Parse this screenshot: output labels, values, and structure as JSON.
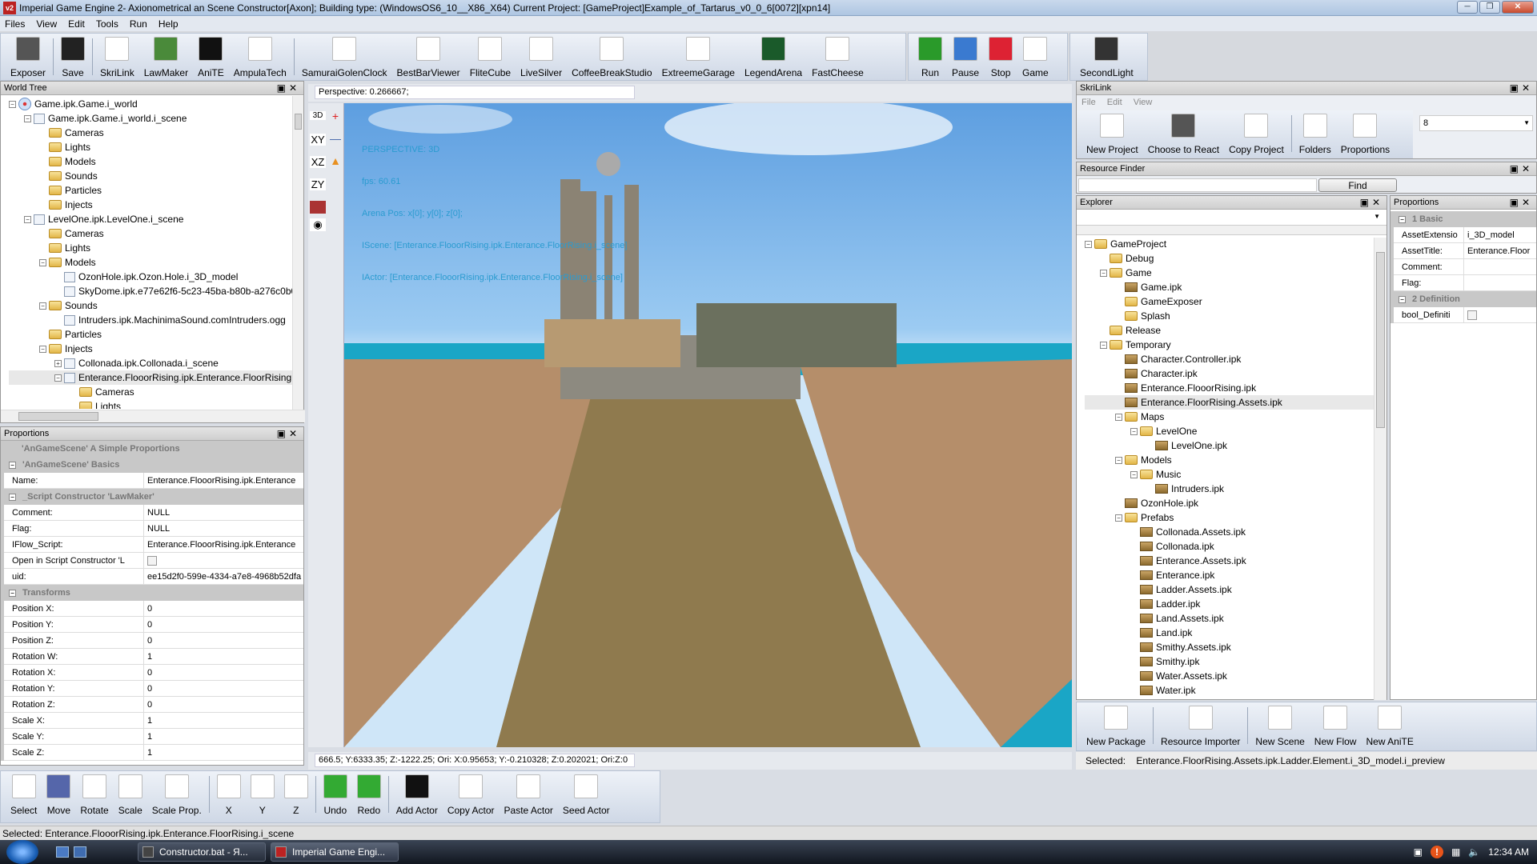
{
  "window": {
    "title": "Imperial Game Engine 2- Axionometrical an Scene Constructor[Axon]; Building type: (WindowsOS6_10__X86_X64) Current Project: [GameProject]Example_of_Tartarus_v0_0_6[0072][xpn14]",
    "app_icon": "v2"
  },
  "menu": [
    "Files",
    "View",
    "Edit",
    "Tools",
    "Run",
    "Help"
  ],
  "toolbar": {
    "group1": [
      {
        "label": "Exposer",
        "icon": "folder-download-icon"
      },
      {
        "label": "Save",
        "icon": "floppy-icon"
      },
      {
        "label": "SkriLink",
        "icon": "eagle-icon"
      },
      {
        "label": "LawMaker",
        "icon": "lawmaker-icon"
      },
      {
        "label": "AniTE",
        "icon": "clapperboard-icon"
      },
      {
        "label": "AmpulaTech",
        "icon": "document-arrow-icon"
      },
      {
        "label": "SamuraiGolenClock",
        "icon": "theater-masks-icon"
      },
      {
        "label": "BestBarViewer",
        "icon": "film-reel-icon"
      },
      {
        "label": "FliteCube",
        "icon": "loop-icon"
      },
      {
        "label": "LiveSilver",
        "icon": "diamond-icon"
      },
      {
        "label": "CoffeeBreakStudio",
        "icon": "network-icon"
      },
      {
        "label": "ExtreemeGarage",
        "icon": "spheres-icon"
      },
      {
        "label": "LegendArena",
        "icon": "arena-icon"
      },
      {
        "label": "FastCheese",
        "icon": "sliders-icon"
      }
    ],
    "group2": [
      {
        "label": "Run",
        "icon": "run-icon"
      },
      {
        "label": "Pause",
        "icon": "pause-icon"
      },
      {
        "label": "Stop",
        "icon": "stop-icon"
      },
      {
        "label": "Game",
        "icon": "game-eagle-icon"
      }
    ],
    "group3": [
      {
        "label": "SecondLight",
        "icon": "lamp-icon"
      }
    ]
  },
  "world_tree": {
    "title": "World Tree",
    "items": [
      {
        "label": "Game.ipk.Game.i_world",
        "depth": 0,
        "icon": "atom",
        "exp": "-"
      },
      {
        "label": "Game.ipk.Game.i_world.i_scene",
        "depth": 1,
        "icon": "cube",
        "exp": "-"
      },
      {
        "label": "Cameras",
        "depth": 2,
        "icon": "folder"
      },
      {
        "label": "Lights",
        "depth": 2,
        "icon": "folder"
      },
      {
        "label": "Models",
        "depth": 2,
        "icon": "folder"
      },
      {
        "label": "Sounds",
        "depth": 2,
        "icon": "folder"
      },
      {
        "label": "Particles",
        "depth": 2,
        "icon": "folder"
      },
      {
        "label": "Injects",
        "depth": 2,
        "icon": "folder"
      },
      {
        "label": "LevelOne.ipk.LevelOne.i_scene",
        "depth": 1,
        "icon": "cube",
        "exp": "-"
      },
      {
        "label": "Cameras",
        "depth": 2,
        "icon": "folder"
      },
      {
        "label": "Lights",
        "depth": 2,
        "icon": "folder"
      },
      {
        "label": "Models",
        "depth": 2,
        "icon": "folder",
        "exp": "-"
      },
      {
        "label": "OzonHole.ipk.Ozon.Hole.i_3D_model",
        "depth": 3,
        "icon": "cube"
      },
      {
        "label": "SkyDome.ipk.e77e62f6-5c23-45ba-b80b-a276c0b0",
        "depth": 3,
        "icon": "cube"
      },
      {
        "label": "Sounds",
        "depth": 2,
        "icon": "folder",
        "exp": "-"
      },
      {
        "label": "Intruders.ipk.MachinimaSound.comIntruders.ogg",
        "depth": 3,
        "icon": "cube"
      },
      {
        "label": "Particles",
        "depth": 2,
        "icon": "folder"
      },
      {
        "label": "Injects",
        "depth": 2,
        "icon": "folder",
        "exp": "-"
      },
      {
        "label": "Collonada.ipk.Collonada.i_scene",
        "depth": 3,
        "icon": "cube",
        "exp": "+"
      },
      {
        "label": "Enterance.FlooorRising.ipk.Enterance.FloorRising",
        "depth": 3,
        "icon": "cube",
        "exp": "-",
        "selected": true
      },
      {
        "label": "Cameras",
        "depth": 4,
        "icon": "folder"
      },
      {
        "label": "Lights",
        "depth": 4,
        "icon": "folder"
      }
    ]
  },
  "proportions_left": {
    "title": "Proportions",
    "header": "'AnGameScene' A Simple Proportions",
    "sections": [
      {
        "name": "'AnGameScene' Basics",
        "rows": [
          {
            "k": "Name:",
            "v": "Enterance.FlooorRising.ipk.Enterance"
          }
        ]
      },
      {
        "name": "_Script Constructor 'LawMaker'",
        "rows": [
          {
            "k": "Comment:",
            "v": "NULL"
          },
          {
            "k": "Flag:",
            "v": "NULL"
          },
          {
            "k": "IFlow_Script:",
            "v": "Enterance.FlooorRising.ipk.Enterance"
          },
          {
            "k": "Open in Script Constructor 'L",
            "v": "",
            "checkbox": true,
            "checked": false
          },
          {
            "k": "uid:",
            "v": "ee15d2f0-599e-4334-a7e8-4968b52dfa"
          }
        ]
      },
      {
        "name": "Transforms",
        "rows": [
          {
            "k": "Position X:",
            "v": "0"
          },
          {
            "k": "Position Y:",
            "v": "0"
          },
          {
            "k": "Position Z:",
            "v": "0"
          },
          {
            "k": "Rotation W:",
            "v": "1"
          },
          {
            "k": "Rotation X:",
            "v": "0"
          },
          {
            "k": "Rotation Y:",
            "v": "0"
          },
          {
            "k": "Rotation Z:",
            "v": "0"
          },
          {
            "k": "Scale X:",
            "v": "1"
          },
          {
            "k": "Scale Y:",
            "v": "1"
          },
          {
            "k": "Scale Z:",
            "v": "1"
          }
        ]
      }
    ]
  },
  "viewport": {
    "perspective_field": "Perspective: 0.266667;",
    "view_buttons": [
      "3D",
      "XY",
      "XZ",
      "ZY"
    ],
    "hud": [
      "PERSPECTIVE: 3D",
      "fps: 60.61",
      "Arena Pos: x[0]; y[0]; z[0];",
      "IScene: [Enterance.FlooorRising.ipk.Enterance.FloorRising.i_scene]",
      "IActor: [Enterance.FlooorRising.ipk.Enterance.FloorRising.i_scene]"
    ],
    "coords": "666.5; Y:6333.35; Z:-1222.25; Ori: X:0.95653; Y:-0.210328; Z:0.202021; Ori:Z:0"
  },
  "bottom_toolbar": [
    {
      "label": "Select",
      "icon": "cursor-icon"
    },
    {
      "label": "Move",
      "icon": "move-axes-icon"
    },
    {
      "label": "Rotate",
      "icon": "rotate-icon"
    },
    {
      "label": "Scale",
      "icon": "scale-icon"
    },
    {
      "label": "Scale Prop.",
      "icon": "scale-prop-icon"
    },
    {
      "label": "X",
      "icon": "axis-x-icon"
    },
    {
      "label": "Y",
      "icon": "axis-y-icon"
    },
    {
      "label": "Z",
      "icon": "axis-z-icon"
    },
    {
      "label": "Undo",
      "icon": "undo-icon"
    },
    {
      "label": "Redo",
      "icon": "redo-icon"
    },
    {
      "label": "Add Actor",
      "icon": "add-actor-icon"
    },
    {
      "label": "Copy Actor",
      "icon": "copy-actor-icon"
    },
    {
      "label": "Paste Actor",
      "icon": "paste-actor-icon"
    },
    {
      "label": "Seed Actor",
      "icon": "seed-actor-icon"
    }
  ],
  "skrilink": {
    "title": "SkriLink",
    "menu": [
      "File",
      "Edit",
      "View"
    ],
    "buttons": [
      {
        "label": "New Project",
        "icon": "new-project-icon"
      },
      {
        "label": "Choose to React",
        "icon": "folder-download-icon"
      },
      {
        "label": "Copy Project",
        "icon": "copy-project-icon"
      },
      {
        "label": "Folders",
        "icon": "folders-icon"
      },
      {
        "label": "Proportions",
        "icon": "magnifier-icon"
      }
    ],
    "combo_value": "8",
    "resource_finder": {
      "title": "Resource Finder",
      "value": "",
      "find_label": "Find"
    },
    "explorer": {
      "title": "Explorer",
      "combo_value": "",
      "items": [
        {
          "label": "GameProject",
          "depth": 0,
          "icon": "folder",
          "exp": "-"
        },
        {
          "label": "Debug",
          "depth": 1,
          "icon": "folder"
        },
        {
          "label": "Game",
          "depth": 1,
          "icon": "folder",
          "exp": "-"
        },
        {
          "label": "Game.ipk",
          "depth": 2,
          "icon": "pkg"
        },
        {
          "label": "GameExposer",
          "depth": 2,
          "icon": "folder"
        },
        {
          "label": "Splash",
          "depth": 2,
          "icon": "folder"
        },
        {
          "label": "Release",
          "depth": 1,
          "icon": "folder"
        },
        {
          "label": "Temporary",
          "depth": 1,
          "icon": "folder",
          "exp": "-"
        },
        {
          "label": "Character.Controller.ipk",
          "depth": 2,
          "icon": "pkg"
        },
        {
          "label": "Character.ipk",
          "depth": 2,
          "icon": "pkg"
        },
        {
          "label": "Enterance.FlooorRising.ipk",
          "depth": 2,
          "icon": "pkg"
        },
        {
          "label": "Enterance.FloorRising.Assets.ipk",
          "depth": 2,
          "icon": "pkg",
          "selected": true
        },
        {
          "label": "Maps",
          "depth": 2,
          "icon": "folder",
          "exp": "-"
        },
        {
          "label": "LevelOne",
          "depth": 3,
          "icon": "folder",
          "exp": "-"
        },
        {
          "label": "LevelOne.ipk",
          "depth": 4,
          "icon": "pkg"
        },
        {
          "label": "Models",
          "depth": 2,
          "icon": "folder",
          "exp": "-"
        },
        {
          "label": "Music",
          "depth": 3,
          "icon": "folder",
          "exp": "-"
        },
        {
          "label": "Intruders.ipk",
          "depth": 4,
          "icon": "pkg"
        },
        {
          "label": "OzonHole.ipk",
          "depth": 2,
          "icon": "pkg"
        },
        {
          "label": "Prefabs",
          "depth": 2,
          "icon": "folder",
          "exp": "-"
        },
        {
          "label": "Collonada.Assets.ipk",
          "depth": 3,
          "icon": "pkg"
        },
        {
          "label": "Collonada.ipk",
          "depth": 3,
          "icon": "pkg"
        },
        {
          "label": "Enterance.Assets.ipk",
          "depth": 3,
          "icon": "pkg"
        },
        {
          "label": "Enterance.ipk",
          "depth": 3,
          "icon": "pkg"
        },
        {
          "label": "Ladder.Assets.ipk",
          "depth": 3,
          "icon": "pkg"
        },
        {
          "label": "Ladder.ipk",
          "depth": 3,
          "icon": "pkg"
        },
        {
          "label": "Land.Assets.ipk",
          "depth": 3,
          "icon": "pkg"
        },
        {
          "label": "Land.ipk",
          "depth": 3,
          "icon": "pkg"
        },
        {
          "label": "Smithy.Assets.ipk",
          "depth": 3,
          "icon": "pkg"
        },
        {
          "label": "Smithy.ipk",
          "depth": 3,
          "icon": "pkg"
        },
        {
          "label": "Water.Assets.ipk",
          "depth": 3,
          "icon": "pkg"
        },
        {
          "label": "Water.ipk",
          "depth": 3,
          "icon": "pkg"
        }
      ]
    },
    "proportions": {
      "title": "Proportions",
      "sections": [
        {
          "name": "1 Basic",
          "rows": [
            {
              "k": "AssetExtensio",
              "v": "i_3D_model"
            },
            {
              "k": "AssetTitle:",
              "v": "Enterance.Floor"
            },
            {
              "k": "Comment:",
              "v": ""
            },
            {
              "k": "Flag:",
              "v": ""
            }
          ]
        },
        {
          "name": "2 Definition",
          "rows": [
            {
              "k": "bool_Definiti",
              "v": "",
              "checkbox": true,
              "checked": false
            }
          ]
        }
      ]
    },
    "bottom_buttons": [
      {
        "label": "New Package",
        "icon": "package-cube-icon"
      },
      {
        "label": "Resource Importer",
        "icon": "eagle-import-icon"
      },
      {
        "label": "New Scene",
        "icon": "scene-cube-icon"
      },
      {
        "label": "New Flow",
        "icon": "flow-icon"
      },
      {
        "label": "New AniTE",
        "icon": "anite-window-icon"
      }
    ],
    "selected_label": "Selected:",
    "selected_value": "Enterance.FloorRising.Assets.ipk.Ladder.Element.i_3D_model.i_preview"
  },
  "status": "Selected: Enterance.FlooorRising.ipk.Enterance.FloorRising.i_scene",
  "taskbar": {
    "tasks": [
      "Constructor.bat - Я...",
      "Imperial Game Engi..."
    ],
    "clock": "12:34 AM"
  },
  "colors": {
    "hud": "#2a9bd0",
    "sky": "#7db6ea",
    "water": "#1aa6c6"
  }
}
